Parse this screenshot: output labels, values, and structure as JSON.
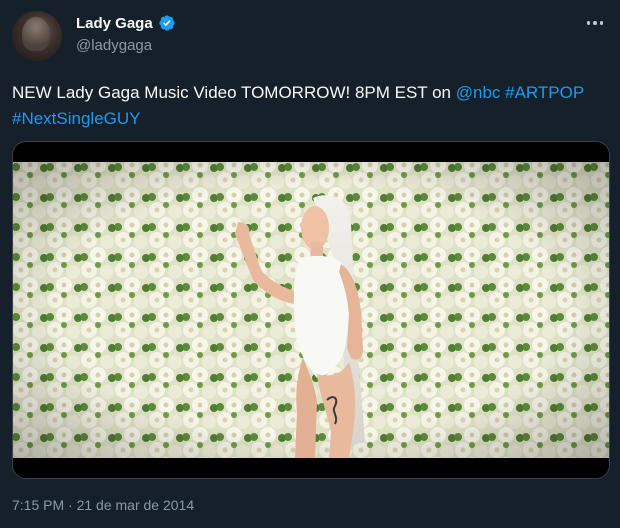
{
  "tweet": {
    "display_name": "Lady Gaga",
    "handle": "@ladygaga",
    "text_part1": "NEW Lady Gaga Music Video TOMORROW! 8PM EST on ",
    "mention": "@nbc",
    "space": " ",
    "hashtag1": "#ARTPOP",
    "hashtag2": "#NextSingleGUY",
    "timestamp": "7:15 PM · 21 de mar de 2014"
  },
  "icons": {
    "verified": "verified-badge-icon",
    "more": "more-options-icon"
  },
  "colors": {
    "background": "#15202b",
    "link": "#1d9bf0",
    "verified": "#1d9bf0",
    "secondary_text": "#8b98a5"
  }
}
